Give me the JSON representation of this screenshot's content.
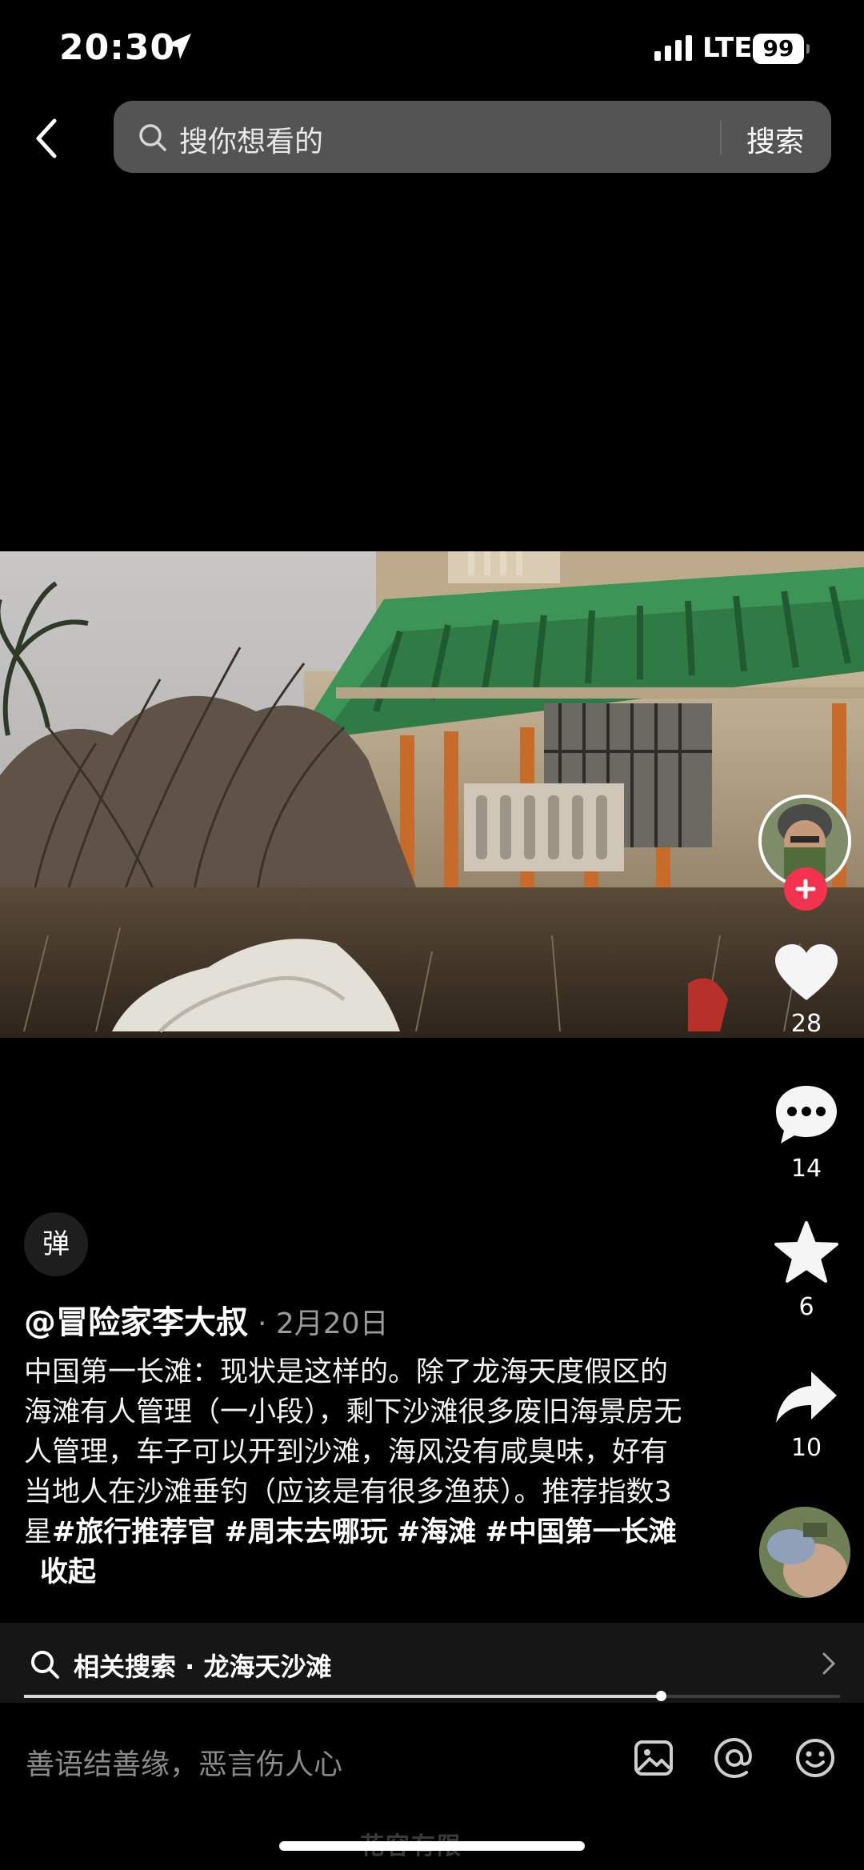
{
  "status_bar": {
    "time": "20:30",
    "network": "LTE",
    "battery": "99"
  },
  "search_bar": {
    "placeholder": "搜你想看的",
    "button": "搜索"
  },
  "rail": {
    "likes": "28",
    "comments": "14",
    "favorites": "6",
    "shares": "10"
  },
  "post": {
    "danmu_label": "弹",
    "author": "@冒险家李大叔",
    "date": "· 2月20日",
    "text": "中国第一长滩：现状是这样的。除了龙海天度假区的海滩有人管理（一小段），剩下沙滩很多废旧海景房无人管理，车子可以开到沙滩，海风没有咸臭味，好有当地人在沙滩垂钓（应该是有很多渔获）。推荐指数3星",
    "tags": [
      "#旅行推荐官",
      "#周末去哪玩",
      "#海滩",
      "#中国第一长滩"
    ],
    "collapse_label": "收起"
  },
  "related": {
    "text": "相关搜索 · 龙海天沙滩"
  },
  "playback": {
    "progress": 0.78
  },
  "comment_bar": {
    "placeholder": "善语结善缘，恶言伤人心"
  },
  "watermark": "花容有限",
  "colors": {
    "follow_badge": "#f2334f",
    "search_bg": "#545454",
    "roof_green": "#2f7a45"
  }
}
